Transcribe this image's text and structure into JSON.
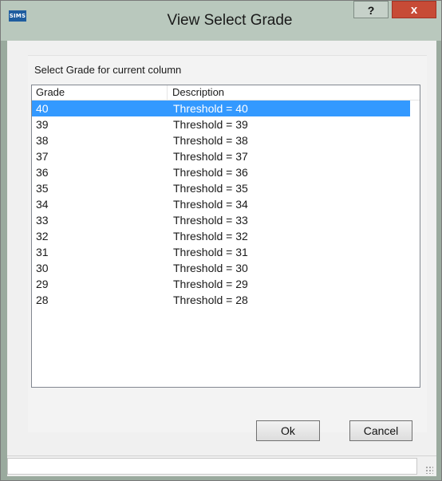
{
  "window": {
    "title": "View Select Grade",
    "app_icon_text": "SIMS",
    "help_label": "?",
    "close_label": "x"
  },
  "group": {
    "label": "Select Grade for current column"
  },
  "list": {
    "columns": [
      "Grade",
      "Description"
    ],
    "selected_index": 0,
    "rows": [
      {
        "grade": "40",
        "description": "Threshold = 40"
      },
      {
        "grade": "39",
        "description": "Threshold = 39"
      },
      {
        "grade": "38",
        "description": "Threshold = 38"
      },
      {
        "grade": "37",
        "description": "Threshold = 37"
      },
      {
        "grade": "36",
        "description": "Threshold = 36"
      },
      {
        "grade": "35",
        "description": "Threshold = 35"
      },
      {
        "grade": "34",
        "description": "Threshold = 34"
      },
      {
        "grade": "33",
        "description": "Threshold = 33"
      },
      {
        "grade": "32",
        "description": "Threshold = 32"
      },
      {
        "grade": "31",
        "description": "Threshold = 31"
      },
      {
        "grade": "30",
        "description": "Threshold = 30"
      },
      {
        "grade": "29",
        "description": "Threshold = 29"
      },
      {
        "grade": "28",
        "description": "Threshold = 28"
      }
    ]
  },
  "buttons": {
    "ok": "Ok",
    "cancel": "Cancel"
  },
  "colors": {
    "titlebar": "#b9c8bd",
    "selection": "#3399ff",
    "close_button": "#c74b36"
  }
}
